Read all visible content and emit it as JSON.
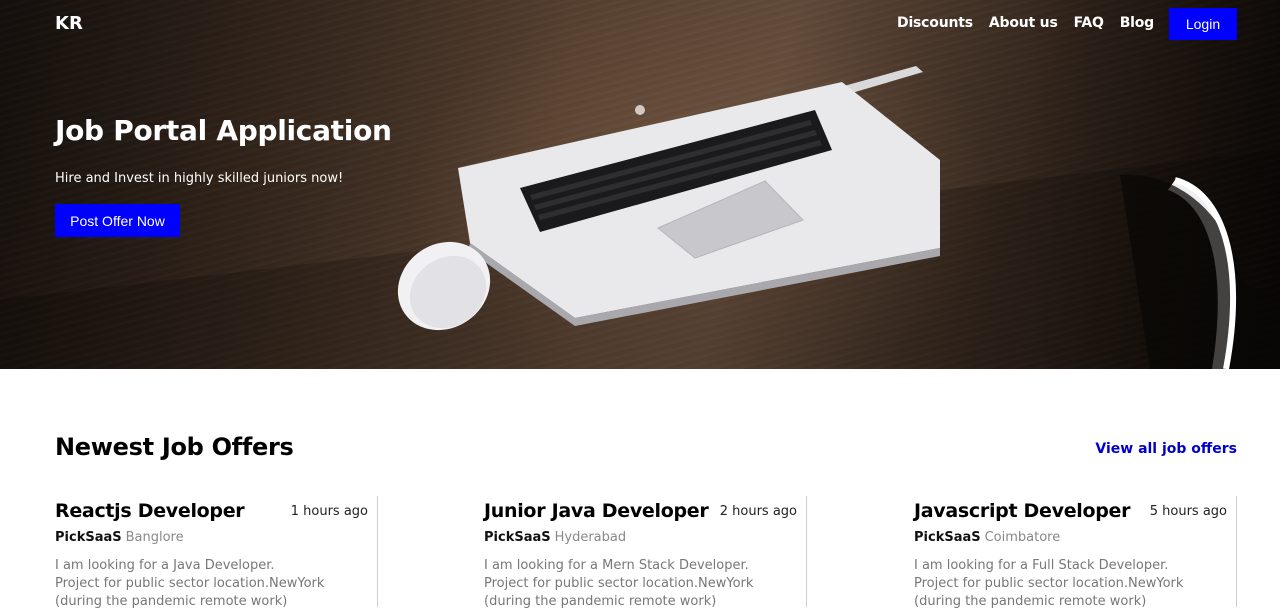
{
  "nav": {
    "logo": "KR",
    "links": [
      "Discounts",
      "About us",
      "FAQ",
      "Blog"
    ],
    "login_label": "Login"
  },
  "hero": {
    "title": "Job Portal Application",
    "subtitle": "Hire and Invest in highly skilled juniors now!",
    "cta_label": "Post Offer Now"
  },
  "offers": {
    "heading": "Newest Job Offers",
    "view_all_label": "View all job offers",
    "cards": [
      {
        "title": "Reactjs Developer",
        "time": "1 hours ago",
        "company": "PickSaaS",
        "location": "Banglore",
        "desc": [
          "I am looking for a Java Developer.",
          "Project for public sector location.NewYork",
          "(during the pandemic remote work)"
        ]
      },
      {
        "title": "Junior Java Developer",
        "time": "2 hours ago",
        "company": "PickSaaS",
        "location": "Hyderabad",
        "desc": [
          "I am looking for a Mern Stack Developer.",
          "Project for public sector location.NewYork",
          "(during the pandemic remote work)"
        ]
      },
      {
        "title": "Javascript Developer",
        "time": "5 hours ago",
        "company": "PickSaaS",
        "location": "Coimbatore",
        "desc": [
          "I am looking for a Full Stack Developer.",
          "Project for public sector location.NewYork",
          "(during the pandemic remote work)"
        ]
      }
    ]
  },
  "colors": {
    "accent": "#0000ff",
    "link": "#0000cc",
    "muted_text": "#777777"
  }
}
